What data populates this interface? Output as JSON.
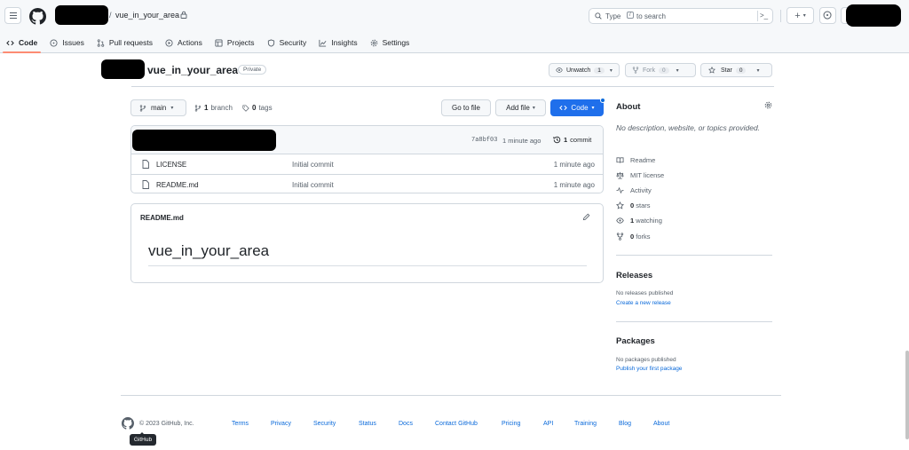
{
  "header": {
    "repo_name": "vue_in_your_area",
    "separator": "/",
    "search": {
      "text_before": "Type",
      "key": "/",
      "text_after": "to search"
    },
    "plus_label": "+"
  },
  "tabs": [
    {
      "label": "Code",
      "icon": "code-icon",
      "active": true
    },
    {
      "label": "Issues",
      "icon": "issue-opened-icon"
    },
    {
      "label": "Pull requests",
      "icon": "git-pull-request-icon"
    },
    {
      "label": "Actions",
      "icon": "play-icon"
    },
    {
      "label": "Projects",
      "icon": "table-icon"
    },
    {
      "label": "Security",
      "icon": "shield-icon"
    },
    {
      "label": "Insights",
      "icon": "graph-icon"
    },
    {
      "label": "Settings",
      "icon": "gear-icon"
    }
  ],
  "repo": {
    "title": "vue_in_your_area",
    "visibility": "Private",
    "watch_label": "Unwatch",
    "watch_count": "1",
    "fork_label": "Fork",
    "fork_count": "0",
    "star_label": "Star",
    "star_count": "0"
  },
  "branch_bar": {
    "branch": "main",
    "branches_count": "1",
    "branches_label": "branch",
    "tags_count": "0",
    "tags_label": "tags",
    "go_to_file": "Go to file",
    "add_file": "Add file",
    "code": "Code"
  },
  "latest_commit": {
    "sha": "7a8bf03",
    "time": "1 minute ago",
    "commits_count": "1",
    "commits_label": "commit"
  },
  "files": [
    {
      "name": "LICENSE",
      "message": "Initial commit",
      "time": "1 minute ago"
    },
    {
      "name": "README.md",
      "message": "Initial commit",
      "time": "1 minute ago"
    }
  ],
  "readme": {
    "filename": "README.md",
    "heading": "vue_in_your_area"
  },
  "sidebar": {
    "about_title": "About",
    "description": "No description, website, or topics provided.",
    "items": [
      {
        "icon": "book-icon",
        "label": "Readme"
      },
      {
        "icon": "law-icon",
        "label": "MIT license"
      },
      {
        "icon": "pulse-icon",
        "label": "Activity"
      },
      {
        "icon": "star-icon",
        "count": "0",
        "label": "stars"
      },
      {
        "icon": "eye-icon",
        "count": "1",
        "label": "watching"
      },
      {
        "icon": "repo-forked-icon",
        "count": "0",
        "label": "forks"
      }
    ],
    "releases_title": "Releases",
    "releases_text": "No releases published",
    "releases_link": "Create a new release",
    "packages_title": "Packages",
    "packages_text": "No packages published",
    "packages_link": "Publish your first package"
  },
  "footer": {
    "copyright": "© 2023 GitHub, Inc.",
    "links": [
      "Terms",
      "Privacy",
      "Security",
      "Status",
      "Docs",
      "Contact GitHub",
      "Pricing",
      "API",
      "Training",
      "Blog",
      "About"
    ],
    "tooltip": "GitHub"
  },
  "colors": {
    "accent_blue": "#1f6feb",
    "link_blue": "#0969da",
    "active_tab_underline": "#fd8c73"
  }
}
